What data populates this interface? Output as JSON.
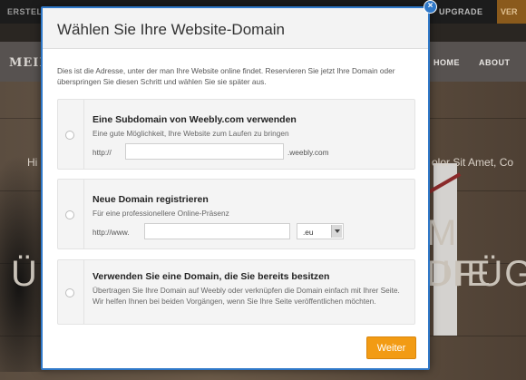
{
  "background": {
    "topbar": {
      "left_label": "ERSTEL",
      "upgrade_label": "UPGRADE",
      "right_label": "VER"
    },
    "header": {
      "brand": "MEIN",
      "nav": [
        "HOME",
        "ABOUT"
      ]
    },
    "hero": {
      "tagline_left": "Hi",
      "tagline_right": "olor Sit Amet, Co",
      "big_top": "M DIE",
      "big_bottom_left": "Ü",
      "big_bottom_right": "UFÜG"
    }
  },
  "modal": {
    "title": "Wählen Sie Ihre Website-Domain",
    "intro": "Dies ist die Adresse, unter der man Ihre Website online findet. Reservieren Sie jetzt Ihre Domain oder überspringen Sie diesen Schritt und wählen Sie sie später aus.",
    "options": [
      {
        "title": "Eine Subdomain von Weebly.com verwenden",
        "subtitle": "Eine gute Möglichkeit, Ihre Website zum Laufen zu bringen",
        "prefix": "http://",
        "input_value": "",
        "suffix": ".weebly.com"
      },
      {
        "title": "Neue Domain registrieren",
        "subtitle": "Für eine professionellere Online-Präsenz",
        "prefix": "http://www.",
        "input_value": "",
        "tld": ".eu"
      },
      {
        "title": "Verwenden Sie eine Domain, die Sie bereits besitzen",
        "subtitle": "Übertragen Sie Ihre Domain auf Weebly oder verknüpfen die Domain einfach mit Ihrer Seite. Wir helfen Ihnen bei beiden Vorgängen, wenn Sie Ihre Seite veröffentlichen möchten."
      }
    ],
    "next_label": "Weiter",
    "close_icon": "×"
  },
  "colors": {
    "accent": "#2f78c8",
    "button": "#f29b14"
  }
}
